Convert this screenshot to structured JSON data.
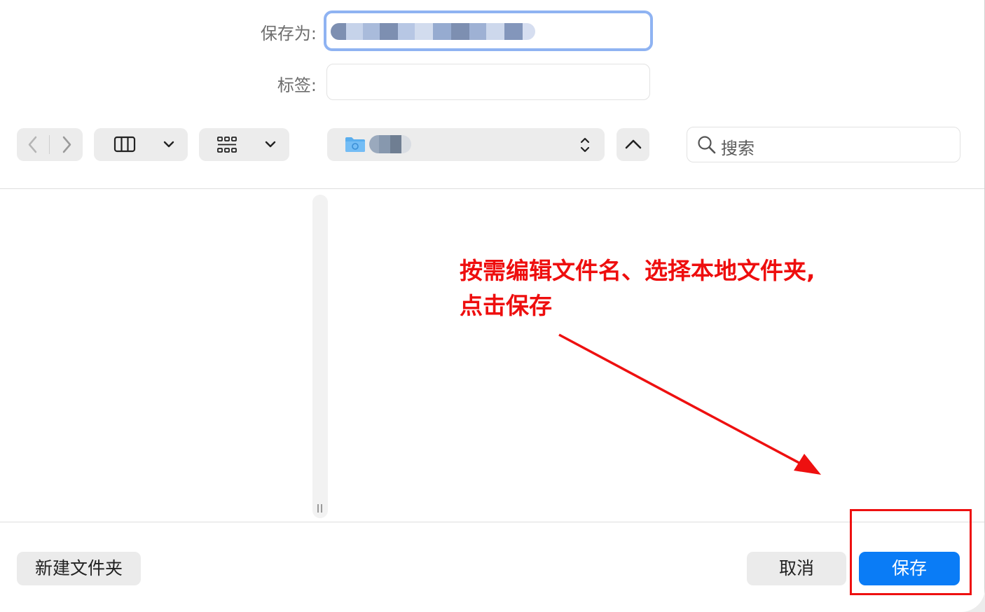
{
  "form": {
    "save_as_label": "保存为:",
    "save_as_value": "",
    "tags_label": "标签:",
    "tags_value": ""
  },
  "toolbar": {
    "location_name": "",
    "search_placeholder": "搜索"
  },
  "annotation": {
    "line1": "按需编辑文件名、选择本地文件夹,",
    "line2": "点击保存"
  },
  "footer": {
    "new_folder_label": "新建文件夹",
    "cancel_label": "取消",
    "save_label": "保存"
  },
  "colors": {
    "accent": "#0a7cf6",
    "focus_ring": "#8fb3f2",
    "annotation_red": "#ee0e0e"
  },
  "icons": {
    "back": "chevron-left-icon",
    "forward": "chevron-right-icon",
    "column_view": "column-view-icon",
    "icon_view": "icon-grid-icon",
    "folder": "folder-icon",
    "updown": "updown-chevron-icon",
    "expand": "chevron-up-icon",
    "search": "search-icon"
  }
}
